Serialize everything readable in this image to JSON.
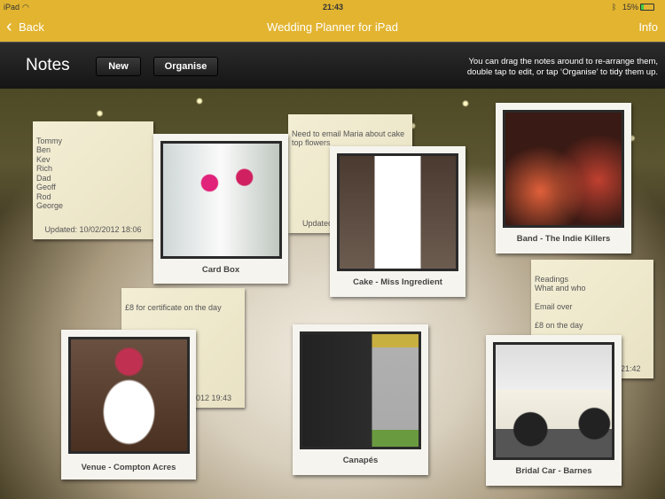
{
  "status": {
    "device": "iPad",
    "time": "21:43",
    "battery": "15%"
  },
  "nav": {
    "back": "Back",
    "title": "Wedding Planner for iPad",
    "info": "Info",
    "bar_color": "#e2b430"
  },
  "toolbar": {
    "title": "Notes",
    "new": "New",
    "organise": "Organise",
    "hint": "You can drag the notes around to re-arrange them,\ndouble tap to edit, or tap ‘Organise’ to tidy them up."
  },
  "notes": [
    {
      "text": "Tommy\nBen\nKev\nRich\nDad\nGeoff\nRod\nGeorge",
      "updated": "Updated: 10/02/2012 18:06"
    },
    {
      "text": "Need to email Maria about cake top flowers",
      "updated": "Updated"
    },
    {
      "text": "£8 for certificate on the day",
      "updated": "012 19:43"
    },
    {
      "text": "Readings\nWhat and who\n\nEmail over\n\n£8 on the day",
      "updated": "21:42"
    }
  ],
  "photos": [
    {
      "caption": "Card Box"
    },
    {
      "caption": "Cake - Miss Ingredient"
    },
    {
      "caption": "Band - The Indie Killers"
    },
    {
      "caption": "Venue - Compton Acres"
    },
    {
      "caption": "Canapés"
    },
    {
      "caption": "Bridal Car - Barnes"
    }
  ]
}
